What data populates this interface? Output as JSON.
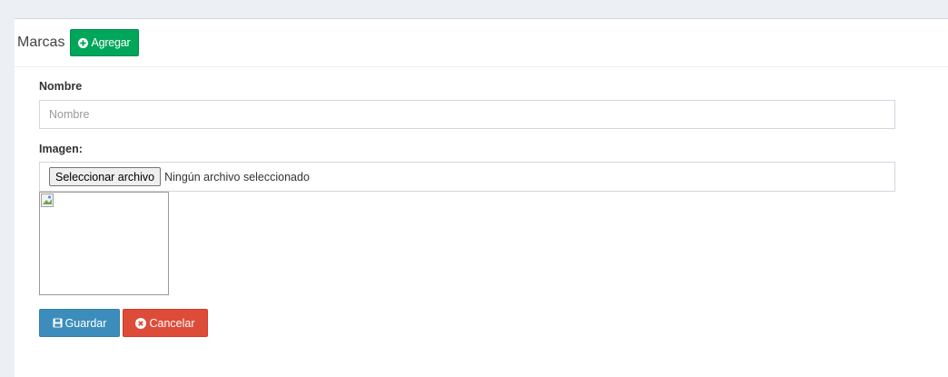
{
  "header": {
    "title": "Marcas",
    "add_button_label": "Agregar"
  },
  "form": {
    "name_label": "Nombre",
    "name_placeholder": "Nombre",
    "name_value": "",
    "image_label": "Imagen:",
    "file_button_label": "Seleccionar archivo",
    "file_status": "Ningún archivo seleccionado"
  },
  "actions": {
    "save_label": "Guardar",
    "cancel_label": "Cancelar"
  },
  "colors": {
    "success": "#00a65a",
    "primary": "#3c8dbc",
    "danger": "#dd4b39"
  },
  "icons": {
    "add": "plus-circle-icon",
    "save": "floppy-disk-icon",
    "cancel": "times-circle-icon",
    "preview": "broken-image-icon"
  }
}
